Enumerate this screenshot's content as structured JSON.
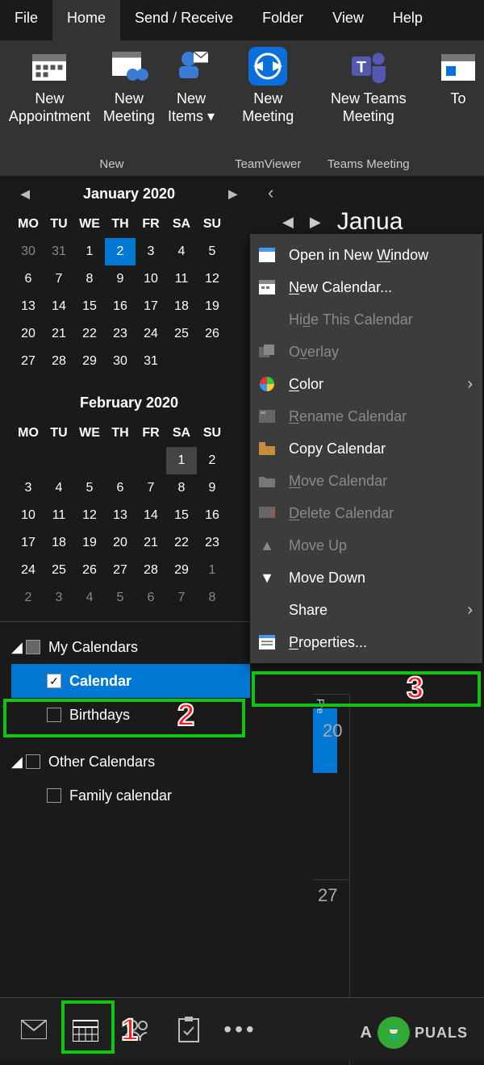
{
  "tabs": {
    "file": "File",
    "home": "Home",
    "send": "Send / Receive",
    "folder": "Folder",
    "view": "View",
    "help": "Help"
  },
  "ribbon": {
    "group_new": "New",
    "group_tv": "TeamViewer",
    "group_teams": "Teams Meeting",
    "new_appt_l1": "New",
    "new_appt_l2": "Appointment",
    "new_meeting_l1": "New",
    "new_meeting_l2": "Meeting",
    "new_items_l1": "New",
    "new_items_l2": "Items",
    "tv_meeting_l1": "New",
    "tv_meeting_l2": "Meeting",
    "teams_meeting_l1": "New Teams",
    "teams_meeting_l2": "Meeting",
    "cut": "To"
  },
  "cal1": {
    "title": "January 2020",
    "dh": [
      "MO",
      "TU",
      "WE",
      "TH",
      "FR",
      "SA",
      "SU"
    ],
    "rows": [
      [
        "30",
        "31",
        "1",
        "2",
        "3",
        "4",
        "5"
      ],
      [
        "6",
        "7",
        "8",
        "9",
        "10",
        "11",
        "12"
      ],
      [
        "13",
        "14",
        "15",
        "16",
        "17",
        "18",
        "19"
      ],
      [
        "20",
        "21",
        "22",
        "23",
        "24",
        "25",
        "26"
      ],
      [
        "27",
        "28",
        "29",
        "30",
        "31",
        "",
        ""
      ]
    ],
    "dim_first": 2,
    "sel": [
      0,
      3
    ]
  },
  "cal2": {
    "title": "February 2020",
    "dh": [
      "MO",
      "TU",
      "WE",
      "TH",
      "FR",
      "SA",
      "SU"
    ],
    "rows": [
      [
        "",
        "",
        "",
        "",
        "",
        "1",
        "2"
      ],
      [
        "3",
        "4",
        "5",
        "6",
        "7",
        "8",
        "9"
      ],
      [
        "10",
        "11",
        "12",
        "13",
        "14",
        "15",
        "16"
      ],
      [
        "17",
        "18",
        "19",
        "20",
        "21",
        "22",
        "23"
      ],
      [
        "24",
        "25",
        "26",
        "27",
        "28",
        "29",
        "1"
      ],
      [
        "2",
        "3",
        "4",
        "5",
        "6",
        "7",
        "8"
      ]
    ],
    "hov": [
      0,
      5
    ],
    "dim_r4_from": 6,
    "dim_r5": true
  },
  "tree": {
    "my": "My Calendars",
    "cal": "Calendar",
    "bdays": "Birthdays",
    "other": "Other Calendars",
    "family": "Family calendar"
  },
  "ctx": {
    "open": "Open in New ",
    "open_u": "W",
    "open2": "indow",
    "new_u": "N",
    "new2": "ew Calendar...",
    "hide": "Hi",
    "hide_u": "d",
    "hide2": "e This Calendar",
    "overlay": "O",
    "overlay_u": "v",
    "overlay2": "erlay",
    "color_u": "C",
    "color2": "olor",
    "rename_u": "R",
    "rename2": "ename Calendar",
    "copy": "Copy Calendar",
    "move_u": "M",
    "move2": "ove Calendar",
    "delete_u": "D",
    "delete2": "elete Calendar",
    "moveup": "Move Up",
    "movedown": "Move Down",
    "share": "Share",
    "props_u": "P",
    "props2": "roperties..."
  },
  "rpane": {
    "title": "Janua",
    "d1": "20",
    "d2": "27"
  },
  "logo": "PUALS"
}
